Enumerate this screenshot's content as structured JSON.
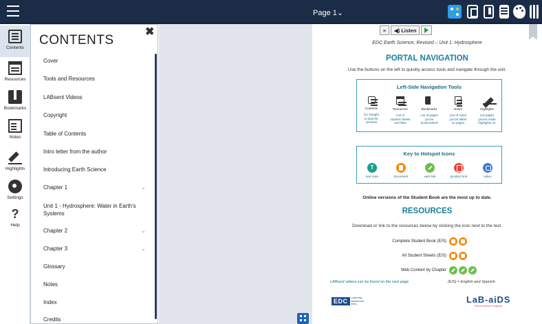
{
  "topbar": {
    "page_label": "Page 1⌄"
  },
  "rail": {
    "items": [
      {
        "label": "Contents"
      },
      {
        "label": "Resources"
      },
      {
        "label": "Bookmarks"
      },
      {
        "label": "Notes"
      },
      {
        "label": "Highlights"
      },
      {
        "label": "Settings"
      },
      {
        "label": "Help"
      }
    ]
  },
  "contents": {
    "title": "CONTENTS",
    "close": "✖",
    "items": [
      {
        "label": "Cover"
      },
      {
        "label": "Tools and Resources"
      },
      {
        "label": "LABsent Videos"
      },
      {
        "label": "Copyright"
      },
      {
        "label": "Table of Contents"
      },
      {
        "label": "Intro letter from the author"
      },
      {
        "label": "Introducing Earth Science"
      },
      {
        "label": "Chapter 1"
      },
      {
        "label": "Unit 1 - Hydrosphere: Water in Earth's Systems"
      },
      {
        "label": "Chapter 2"
      },
      {
        "label": "Chapter 3"
      },
      {
        "label": "Glossary"
      },
      {
        "label": "Notes"
      },
      {
        "label": "Index"
      },
      {
        "label": "Credits"
      }
    ],
    "chevron": "⌄"
  },
  "page": {
    "listen_label": "◀) Listen",
    "subtitle": "EDC Earth Science, Revised – Unit 1: Hydrosphere",
    "portal_heading": "PORTAL NAVIGATION",
    "portal_text": "Use the buttons on the left to quickly access tools and navigate through the unit.",
    "nav_tools": {
      "title": "Left-Side Navigation Tools",
      "items": [
        {
          "name": "Contents",
          "desc1": "Go straight",
          "desc2": "to specific",
          "desc3": "sections"
        },
        {
          "name": "Resources",
          "desc1": "List of",
          "desc2": "student sheets",
          "desc3": "and links"
        },
        {
          "name": "Bookmarks",
          "desc1": "List of pages",
          "desc2": "you've",
          "desc3": "bookmarked"
        },
        {
          "name": "Notes",
          "desc1": "List of notes",
          "desc2": "you've taken",
          "desc3": "on pages"
        },
        {
          "name": "Highlights",
          "desc1": "List pages",
          "desc2": "you've made",
          "desc3": "highlights on"
        }
      ]
    },
    "hotspots": {
      "title": "Key to Hotspot Icons",
      "items": [
        {
          "name": "text note"
        },
        {
          "name": "document"
        },
        {
          "name": "web link"
        },
        {
          "name": "product link"
        },
        {
          "name": "video"
        }
      ]
    },
    "online_note": "Online versions of the Student Book are the most up to date.",
    "resources_heading": "RESOURCES",
    "resources_text": "Download or link to the resources below by clicking the icon next to the text.",
    "resources": [
      {
        "label": "Complete Student Book (E/S)"
      },
      {
        "label": "All Student Sheets (E/S)"
      },
      {
        "label": "Web Content by Chapter"
      }
    ],
    "footnote_left": "LABsent videos can be found on the next page",
    "footnote_right": "(E/S) = English and Spanish",
    "edc_mark": "EDC",
    "edc_tag": "Learning transforms lives.",
    "labaids_mark": "LaB-aiDS",
    "labaids_tag": "Proven Science Programs"
  }
}
